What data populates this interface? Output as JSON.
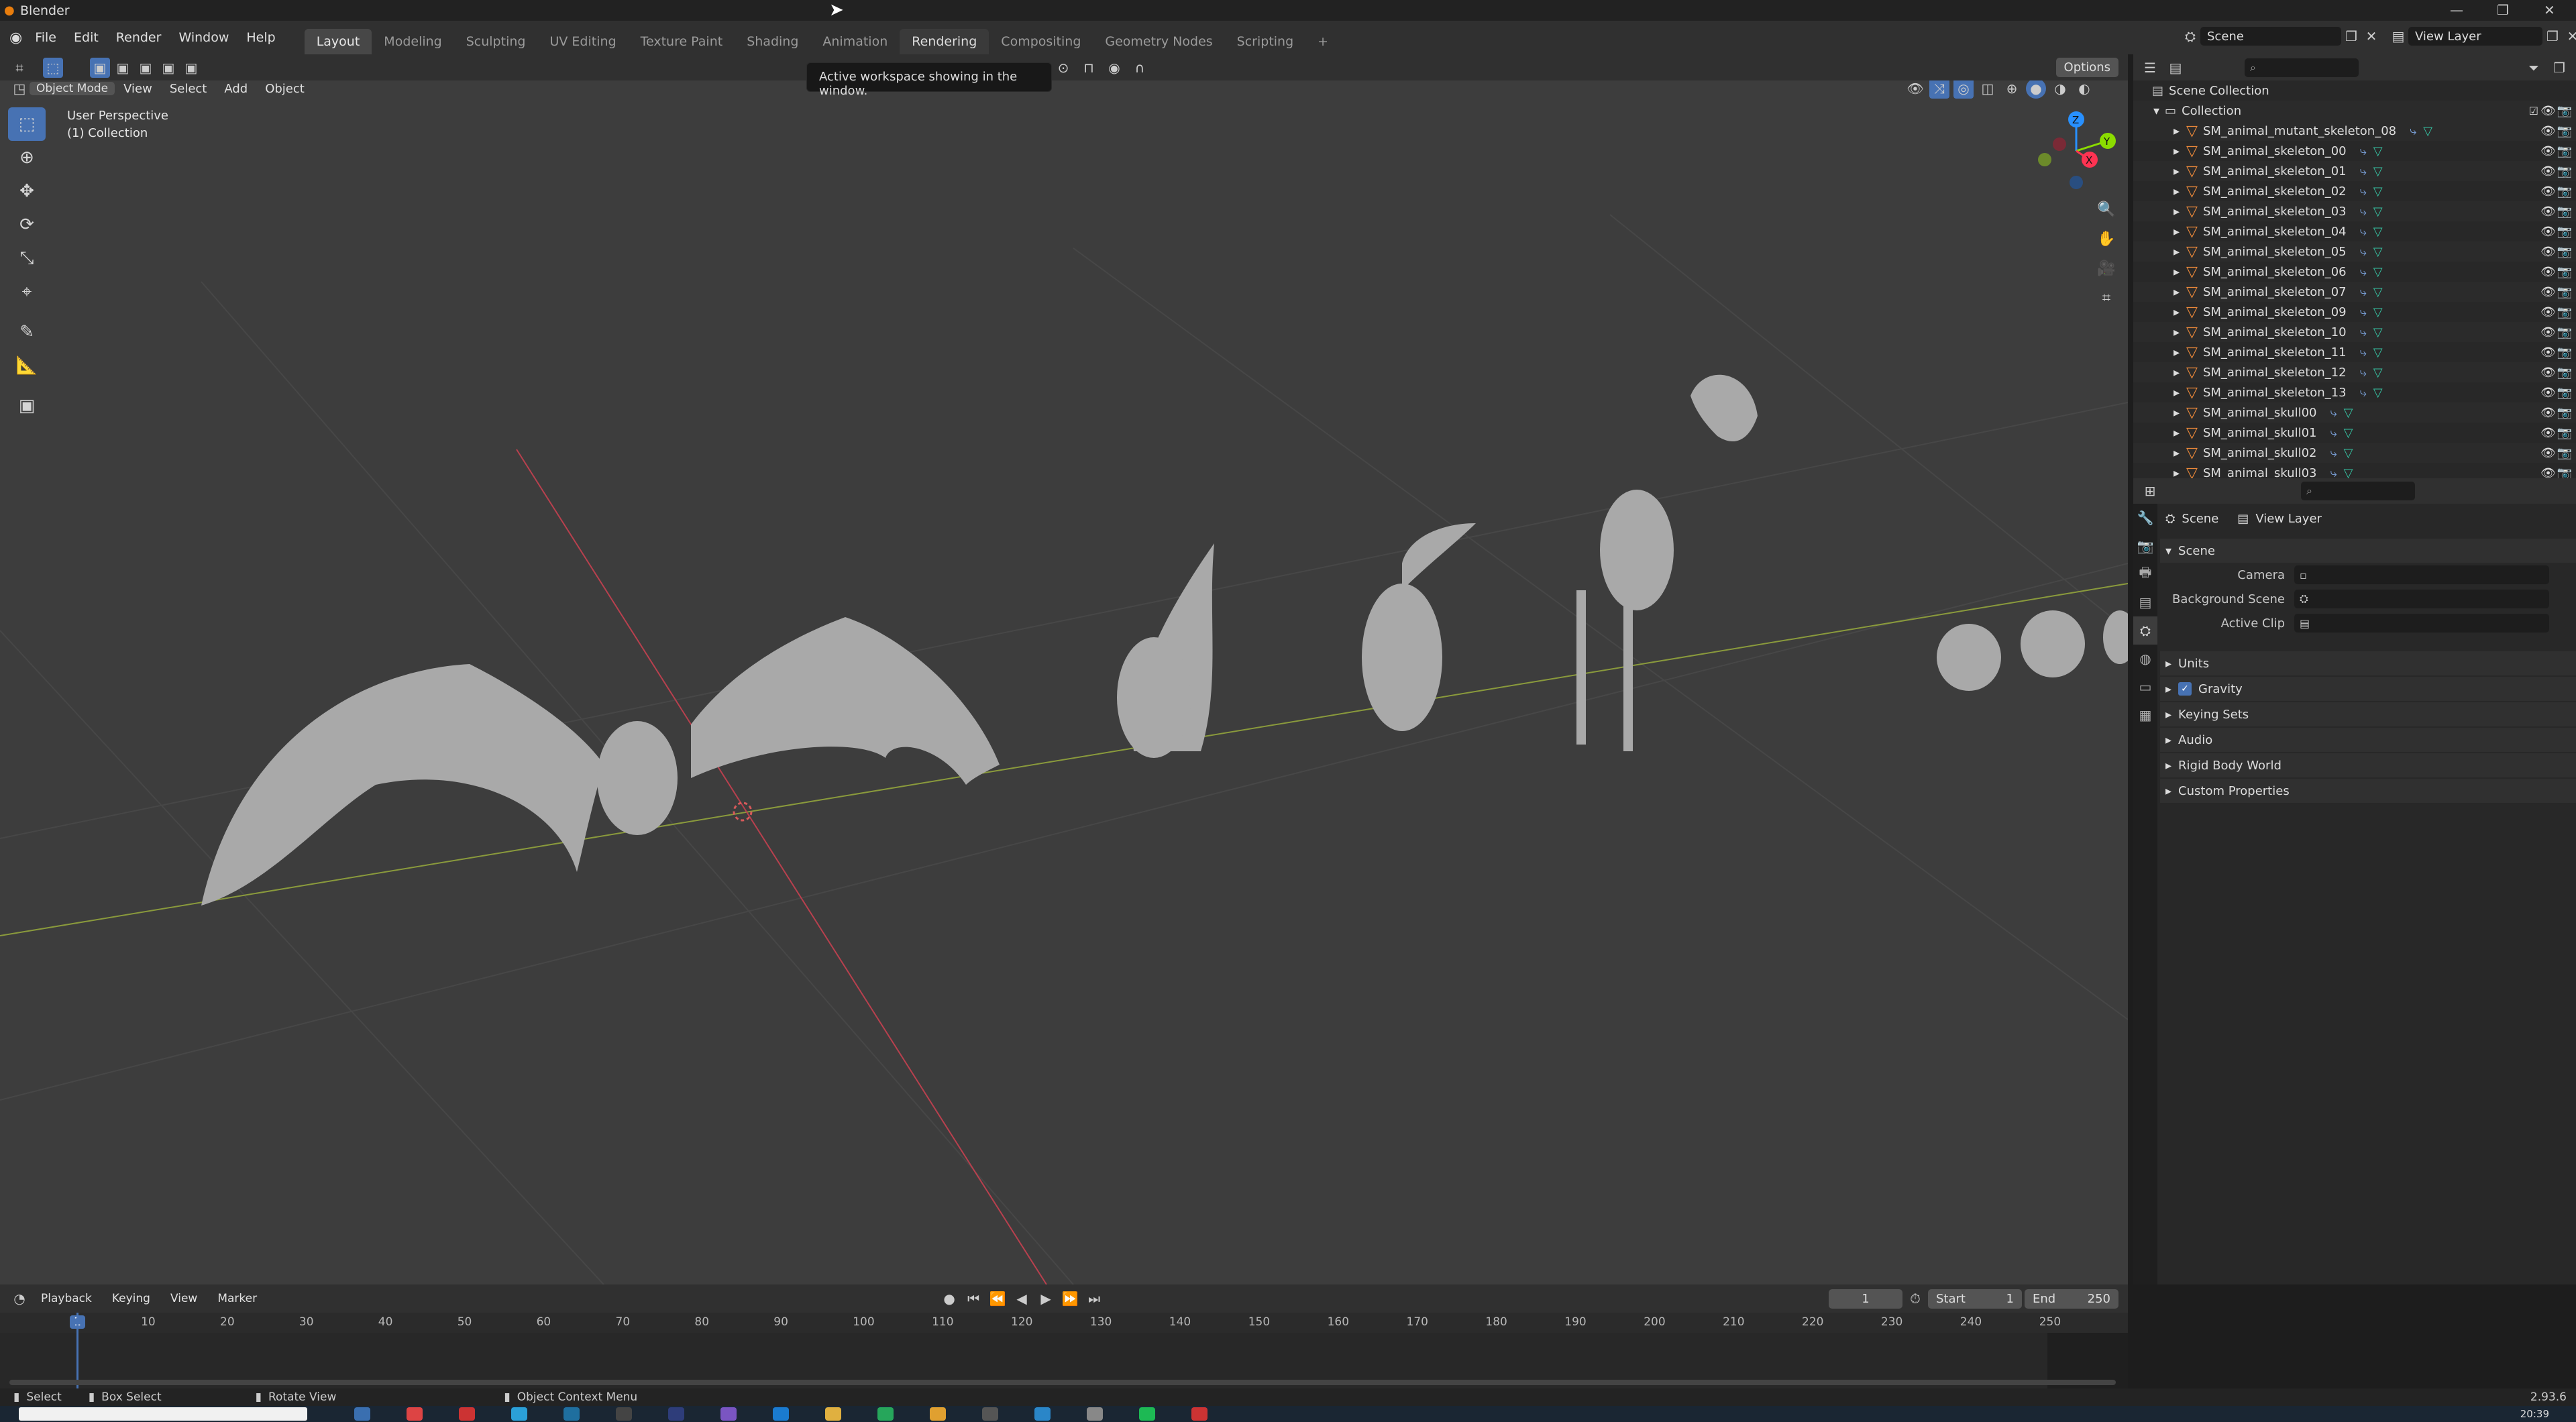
{
  "window": {
    "title": "Blender",
    "controls": [
      "—",
      "❐",
      "✕"
    ]
  },
  "menu": {
    "items": [
      "File",
      "Edit",
      "Render",
      "Window",
      "Help"
    ]
  },
  "workspaces": {
    "active": "Layout",
    "tabs": [
      "Layout",
      "Modeling",
      "Sculpting",
      "UV Editing",
      "Texture Paint",
      "Shading",
      "Animation",
      "Rendering",
      "Compositing",
      "Geometry Nodes",
      "Scripting"
    ],
    "add": "+"
  },
  "scene_selector": {
    "scene": "Scene",
    "view_layer": "View Layer"
  },
  "tooltip": {
    "text": "Active workspace showing in the window."
  },
  "viewport_header": {
    "mode": "Object Mode",
    "menus": [
      "View",
      "Select",
      "Add",
      "Object"
    ],
    "options": "Options"
  },
  "viewport": {
    "perspective": "User Perspective",
    "collection": "(1) Collection",
    "gizmo": {
      "z": "Z",
      "y": "Y",
      "x": "X"
    }
  },
  "outliner": {
    "root": "Scene Collection",
    "collection": "Collection",
    "items": [
      "SM_animal_mutant_skeleton_08",
      "SM_animal_skeleton_00",
      "SM_animal_skeleton_01",
      "SM_animal_skeleton_02",
      "SM_animal_skeleton_03",
      "SM_animal_skeleton_04",
      "SM_animal_skeleton_05",
      "SM_animal_skeleton_06",
      "SM_animal_skeleton_07",
      "SM_animal_skeleton_09",
      "SM_animal_skeleton_10",
      "SM_animal_skeleton_11",
      "SM_animal_skeleton_12",
      "SM_animal_skeleton_13",
      "SM_animal_skull00",
      "SM_animal_skull01",
      "SM_animal_skull02",
      "SM_animal_skull03"
    ]
  },
  "properties": {
    "breadcrumb": [
      "Scene",
      "View Layer"
    ],
    "section": "Scene",
    "fields": {
      "camera": "Camera",
      "background_scene": "Background Scene",
      "active_clip": "Active Clip"
    },
    "panels": [
      "Units",
      "Gravity",
      "Keying Sets",
      "Audio",
      "Rigid Body World",
      "Custom Properties"
    ],
    "gravity_checked": true
  },
  "timeline": {
    "menus": [
      "Playback",
      "Keying",
      "View",
      "Marker"
    ],
    "current_frame": "1",
    "start_label": "Start",
    "start": "1",
    "end_label": "End",
    "end": "250",
    "ticks": [
      "1",
      "10",
      "20",
      "30",
      "40",
      "50",
      "60",
      "70",
      "80",
      "90",
      "100",
      "110",
      "120",
      "130",
      "140",
      "150",
      "160",
      "170",
      "180",
      "190",
      "200",
      "210",
      "220",
      "230",
      "240",
      "250"
    ]
  },
  "statusbar": {
    "select": "Select",
    "box_select": "Box Select",
    "rotate_view": "Rotate View",
    "context_menu": "Object Context Menu",
    "version": "2.93.6"
  },
  "taskbar": {
    "time": "20:39"
  },
  "colors": {
    "accent": "#4772b3",
    "object": "#e9883a",
    "mesh": "#36c3a3",
    "x_axis": "#ff3352",
    "y_axis": "#8bdc00",
    "z_axis": "#2890ff"
  }
}
